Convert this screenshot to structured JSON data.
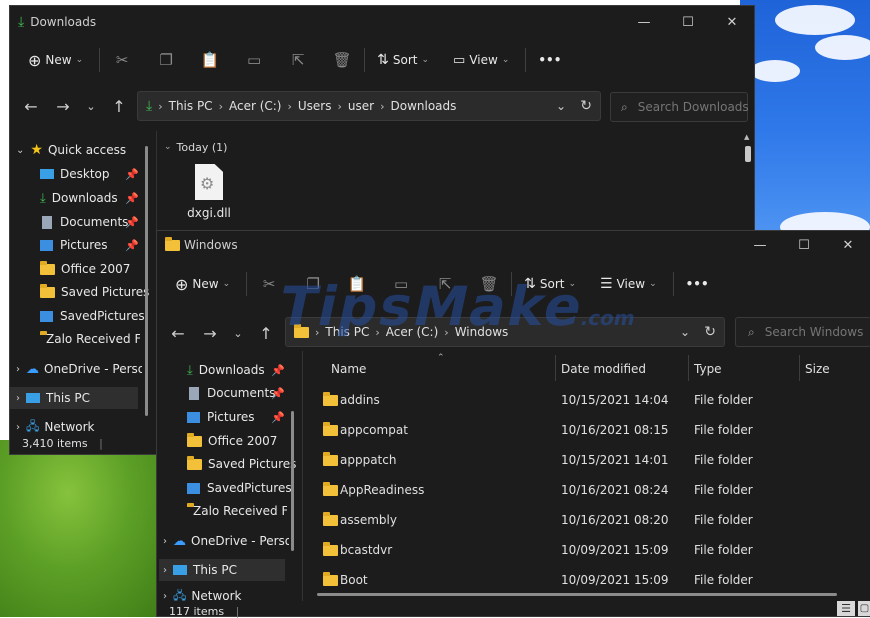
{
  "colors": {
    "window_bg": "#1c1c1c",
    "accent_green": "#3fb950",
    "folder": "#f3c03a",
    "watermark": "#2a55a8"
  },
  "watermark": {
    "text": "TipsMake",
    "suffix": ".com"
  },
  "win1": {
    "title": "Downloads",
    "toolbar": {
      "new": "New",
      "sort": "Sort",
      "view": "View",
      "more": "•••"
    },
    "path": [
      "This PC",
      "Acer (C:)",
      "Users",
      "user",
      "Downloads"
    ],
    "search_placeholder": "Search Downloads",
    "group": "Today (1)",
    "file": {
      "name": "dxgi.dll"
    },
    "sidebar": [
      {
        "label": "Quick access",
        "icon": "star-icon"
      },
      {
        "label": "Desktop",
        "icon": "desktop-icon"
      },
      {
        "label": "Downloads",
        "icon": "download-icon"
      },
      {
        "label": "Documents",
        "icon": "document-icon"
      },
      {
        "label": "Pictures",
        "icon": "pictures-icon"
      },
      {
        "label": "Office 2007",
        "icon": "folder-icon"
      },
      {
        "label": "Saved Pictures",
        "icon": "folder-icon"
      },
      {
        "label": "SavedPictures",
        "icon": "pictures-icon"
      },
      {
        "label": "Zalo Received Fi",
        "icon": "folder-icon"
      },
      {
        "label": "OneDrive - Person",
        "icon": "cloud-icon"
      },
      {
        "label": "This PC",
        "icon": "pc-icon"
      },
      {
        "label": "Network",
        "icon": "network-icon"
      }
    ],
    "status": "3,410 items"
  },
  "win2": {
    "title": "Windows",
    "toolbar": {
      "new": "New",
      "sort": "Sort",
      "view": "View",
      "more": "•••"
    },
    "path": [
      "This PC",
      "Acer (C:)",
      "Windows"
    ],
    "search_placeholder": "Search Windows",
    "sidebar": [
      {
        "label": "Downloads",
        "icon": "download-icon"
      },
      {
        "label": "Documents",
        "icon": "document-icon"
      },
      {
        "label": "Pictures",
        "icon": "pictures-icon"
      },
      {
        "label": "Office 2007",
        "icon": "folder-icon"
      },
      {
        "label": "Saved Pictures",
        "icon": "folder-icon"
      },
      {
        "label": "SavedPictures",
        "icon": "pictures-icon"
      },
      {
        "label": "Zalo Received Fi",
        "icon": "folder-icon"
      },
      {
        "label": "OneDrive - Person",
        "icon": "cloud-icon"
      },
      {
        "label": "This PC",
        "icon": "pc-icon"
      },
      {
        "label": "Network",
        "icon": "network-icon"
      }
    ],
    "columns": {
      "name": "Name",
      "date": "Date modified",
      "type": "Type",
      "size": "Size"
    },
    "rows": [
      {
        "name": "addins",
        "date": "10/15/2021 14:04",
        "type": "File folder"
      },
      {
        "name": "appcompat",
        "date": "10/16/2021 08:15",
        "type": "File folder"
      },
      {
        "name": "apppatch",
        "date": "10/15/2021 14:01",
        "type": "File folder"
      },
      {
        "name": "AppReadiness",
        "date": "10/16/2021 08:24",
        "type": "File folder"
      },
      {
        "name": "assembly",
        "date": "10/16/2021 08:20",
        "type": "File folder"
      },
      {
        "name": "bcastdvr",
        "date": "10/09/2021 15:09",
        "type": "File folder"
      },
      {
        "name": "Boot",
        "date": "10/09/2021 15:09",
        "type": "File folder"
      }
    ],
    "status": "117 items"
  }
}
